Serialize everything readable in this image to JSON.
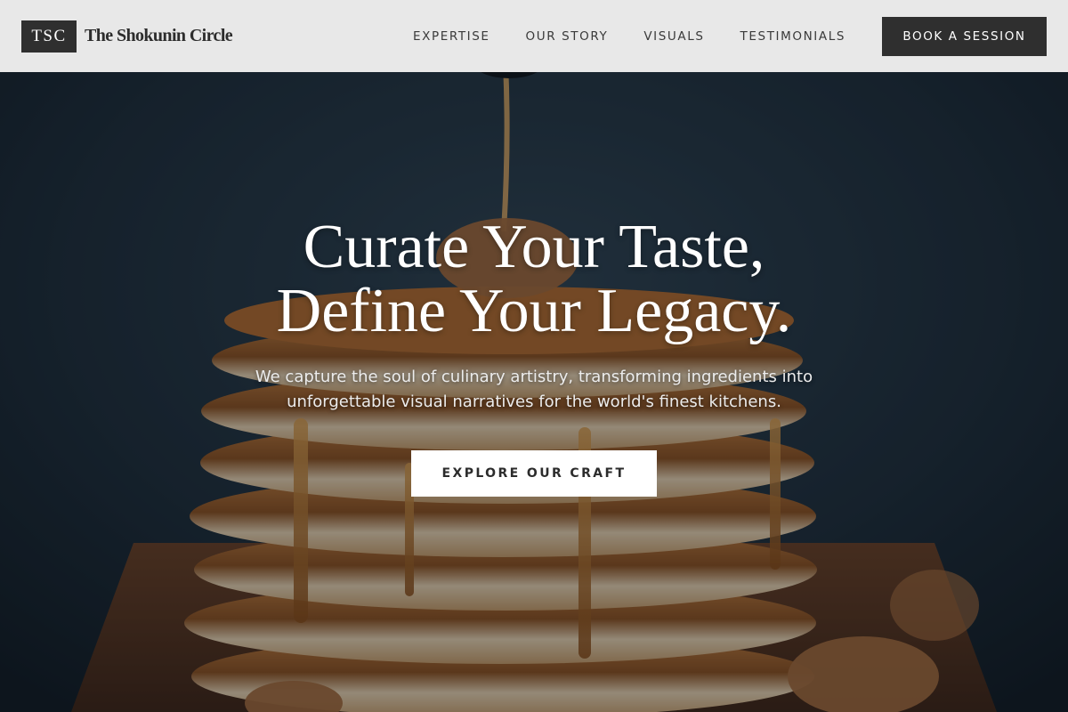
{
  "brand": {
    "mark": "TSC",
    "name": "The Shokunin Circle"
  },
  "nav": {
    "items": [
      {
        "label": "EXPERTISE"
      },
      {
        "label": "OUR STORY"
      },
      {
        "label": "VISUALS"
      },
      {
        "label": "TESTIMONIALS"
      }
    ],
    "cta_label": "BOOK A SESSION"
  },
  "hero": {
    "headline_line1": "Curate Your Taste,",
    "headline_line2": "Define Your Legacy.",
    "subtext_line1": "We capture the soul of culinary artistry, transforming ingredients into",
    "subtext_line2": "unforgettable visual narratives for the world's finest kitchens.",
    "cta_label": "EXPLORE OUR CRAFT",
    "background_image": "pancake-stack-with-syrup-and-walnuts"
  },
  "colors": {
    "header_bg": "#e8e8e8",
    "dark_button": "#2f2f2f",
    "light_button": "#ffffff",
    "hero_text": "#ffffff"
  }
}
